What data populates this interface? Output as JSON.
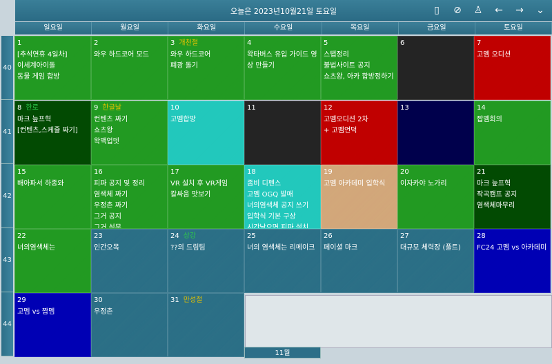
{
  "header": {
    "title": "오늘은 2023년10월21일 토요일",
    "icons": [
      "phone-icon",
      "sync-icon",
      "user-icon",
      "arrow-left-icon",
      "arrow-right-icon",
      "chevron-down-icon"
    ]
  },
  "weekdays": [
    "일요일",
    "월요일",
    "화요일",
    "수요일",
    "목요일",
    "금요일",
    "토요일"
  ],
  "weeks": [
    "40",
    "41",
    "42",
    "43",
    "44"
  ],
  "colors": {
    "green": "#229a22",
    "darkgreen": "#024a02",
    "cyan": "#22c8bc",
    "dark": "#242424",
    "red": "#c00000",
    "navy": "#00004c",
    "tan": "#d2a77a",
    "teal": "#2b6f86",
    "blue": "#0000b4",
    "holiday_yellow": "#e6c200",
    "holiday_green": "#2ec84a"
  },
  "days": [
    {
      "d": "1",
      "c": "green",
      "ev": [
        "[추석연휴 4일차]",
        "이세계아이돌",
        "동물 게임 합방"
      ]
    },
    {
      "d": "2",
      "c": "green",
      "ev": [
        "와우 하드코어 모드"
      ]
    },
    {
      "d": "3",
      "c": "green",
      "h": "개천절",
      "hc": "holiday_yellow",
      "ev": [
        "와우 하드코어",
        "폐광 돌기"
      ]
    },
    {
      "d": "4",
      "c": "green",
      "ev": [
        "왁타버스 유입 가이드 영",
        "상 만들기"
      ]
    },
    {
      "d": "5",
      "c": "green",
      "ev": [
        "스탭정리",
        "불법사이트 공지",
        "쇼츠왕, 아카 합방정하기"
      ]
    },
    {
      "d": "6",
      "c": "dark",
      "ev": []
    },
    {
      "d": "7",
      "c": "red",
      "ev": [
        "고멤 오디션"
      ]
    },
    {
      "d": "8",
      "c": "darkgreen",
      "h": "한로",
      "hc": "holiday_green",
      "ev": [
        "마크 늪프혁",
        "[컨텐츠,스케쥴 짜기]"
      ]
    },
    {
      "d": "9",
      "c": "green",
      "h": "한글날",
      "hc": "holiday_yellow",
      "ev": [
        "컨텐츠 짜기",
        "쇼츠왕",
        "왁맥업뎃"
      ]
    },
    {
      "d": "10",
      "c": "cyan",
      "ev": [
        "고멤합방"
      ]
    },
    {
      "d": "11",
      "c": "dark",
      "ev": []
    },
    {
      "d": "12",
      "c": "red",
      "ev": [
        "고멤오디션 2차",
        "+ 고멤언덕"
      ]
    },
    {
      "d": "13",
      "c": "navy",
      "ev": []
    },
    {
      "d": "14",
      "c": "green",
      "ev": [
        "짭멤회의"
      ]
    },
    {
      "d": "15",
      "c": "green",
      "ev": [
        "배아파서 하종와"
      ]
    },
    {
      "d": "16",
      "c": "green",
      "ev": [
        "피파 공지 및 정리",
        "염색체 짜기",
        "우정촌 짜기",
        "그거 공지",
        "그거 석무"
      ]
    },
    {
      "d": "17",
      "c": "green",
      "ev": [
        "VR 설치 후 VR게임",
        "칼싸움 맛보기"
      ]
    },
    {
      "d": "18",
      "c": "cyan",
      "ev": [
        "좀비 디펜스",
        "고멤 OGQ 발매",
        "너의염색체 공지 쓰기",
        "입학식 기본 구상",
        "시간남으면 피파 설치"
      ]
    },
    {
      "d": "19",
      "c": "tan",
      "ev": [
        "고멤 아카데미 입학식"
      ]
    },
    {
      "d": "20",
      "c": "green",
      "ev": [
        "이자카야 노가리"
      ]
    },
    {
      "d": "21",
      "c": "darkgreen",
      "ev": [
        "마크 늪프혁",
        "작곡캠프 공지",
        "염색체마무리"
      ]
    },
    {
      "d": "22",
      "c": "green",
      "ev": [
        "너의염색체는"
      ]
    },
    {
      "d": "23",
      "c": "teal",
      "ev": [
        "인간오목"
      ]
    },
    {
      "d": "24",
      "c": "teal",
      "h": "상강",
      "hc": "holiday_green",
      "ev": [
        "??의 드림팀"
      ]
    },
    {
      "d": "25",
      "c": "teal",
      "ev": [
        "너의 염색체는 리메이크"
      ]
    },
    {
      "d": "26",
      "c": "teal",
      "ev": [
        "페이셜 마크"
      ]
    },
    {
      "d": "27",
      "c": "teal",
      "ev": [
        "대규모 체력장 (풀트)"
      ]
    },
    {
      "d": "28",
      "c": "blue",
      "ev": [
        "FC24 고멤 vs 아카데미"
      ]
    },
    {
      "d": "29",
      "c": "blue",
      "ev": [
        "고멤 vs 짭멤"
      ]
    },
    {
      "d": "30",
      "c": "teal",
      "ev": [
        "우정촌"
      ]
    },
    {
      "d": "31",
      "c": "teal",
      "h": "만성절",
      "hc": "holiday_yellow",
      "ev": []
    }
  ],
  "next_month_label": "11월"
}
